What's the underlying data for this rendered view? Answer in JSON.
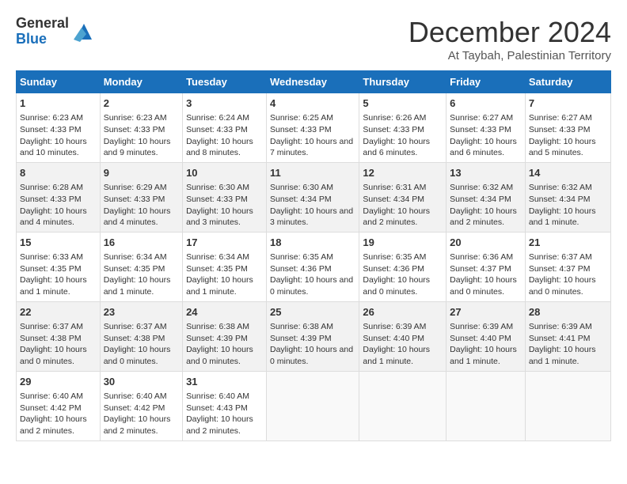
{
  "app": {
    "logo_line1": "General",
    "logo_line2": "Blue"
  },
  "title": "December 2024",
  "location": "At Taybah, Palestinian Territory",
  "days_of_week": [
    "Sunday",
    "Monday",
    "Tuesday",
    "Wednesday",
    "Thursday",
    "Friday",
    "Saturday"
  ],
  "weeks": [
    [
      {
        "day": "1",
        "sunrise": "6:23 AM",
        "sunset": "4:33 PM",
        "daylight": "10 hours and 10 minutes."
      },
      {
        "day": "2",
        "sunrise": "6:23 AM",
        "sunset": "4:33 PM",
        "daylight": "10 hours and 9 minutes."
      },
      {
        "day": "3",
        "sunrise": "6:24 AM",
        "sunset": "4:33 PM",
        "daylight": "10 hours and 8 minutes."
      },
      {
        "day": "4",
        "sunrise": "6:25 AM",
        "sunset": "4:33 PM",
        "daylight": "10 hours and 7 minutes."
      },
      {
        "day": "5",
        "sunrise": "6:26 AM",
        "sunset": "4:33 PM",
        "daylight": "10 hours and 6 minutes."
      },
      {
        "day": "6",
        "sunrise": "6:27 AM",
        "sunset": "4:33 PM",
        "daylight": "10 hours and 6 minutes."
      },
      {
        "day": "7",
        "sunrise": "6:27 AM",
        "sunset": "4:33 PM",
        "daylight": "10 hours and 5 minutes."
      }
    ],
    [
      {
        "day": "8",
        "sunrise": "6:28 AM",
        "sunset": "4:33 PM",
        "daylight": "10 hours and 4 minutes."
      },
      {
        "day": "9",
        "sunrise": "6:29 AM",
        "sunset": "4:33 PM",
        "daylight": "10 hours and 4 minutes."
      },
      {
        "day": "10",
        "sunrise": "6:30 AM",
        "sunset": "4:33 PM",
        "daylight": "10 hours and 3 minutes."
      },
      {
        "day": "11",
        "sunrise": "6:30 AM",
        "sunset": "4:34 PM",
        "daylight": "10 hours and 3 minutes."
      },
      {
        "day": "12",
        "sunrise": "6:31 AM",
        "sunset": "4:34 PM",
        "daylight": "10 hours and 2 minutes."
      },
      {
        "day": "13",
        "sunrise": "6:32 AM",
        "sunset": "4:34 PM",
        "daylight": "10 hours and 2 minutes."
      },
      {
        "day": "14",
        "sunrise": "6:32 AM",
        "sunset": "4:34 PM",
        "daylight": "10 hours and 1 minute."
      }
    ],
    [
      {
        "day": "15",
        "sunrise": "6:33 AM",
        "sunset": "4:35 PM",
        "daylight": "10 hours and 1 minute."
      },
      {
        "day": "16",
        "sunrise": "6:34 AM",
        "sunset": "4:35 PM",
        "daylight": "10 hours and 1 minute."
      },
      {
        "day": "17",
        "sunrise": "6:34 AM",
        "sunset": "4:35 PM",
        "daylight": "10 hours and 1 minute."
      },
      {
        "day": "18",
        "sunrise": "6:35 AM",
        "sunset": "4:36 PM",
        "daylight": "10 hours and 0 minutes."
      },
      {
        "day": "19",
        "sunrise": "6:35 AM",
        "sunset": "4:36 PM",
        "daylight": "10 hours and 0 minutes."
      },
      {
        "day": "20",
        "sunrise": "6:36 AM",
        "sunset": "4:37 PM",
        "daylight": "10 hours and 0 minutes."
      },
      {
        "day": "21",
        "sunrise": "6:37 AM",
        "sunset": "4:37 PM",
        "daylight": "10 hours and 0 minutes."
      }
    ],
    [
      {
        "day": "22",
        "sunrise": "6:37 AM",
        "sunset": "4:38 PM",
        "daylight": "10 hours and 0 minutes."
      },
      {
        "day": "23",
        "sunrise": "6:37 AM",
        "sunset": "4:38 PM",
        "daylight": "10 hours and 0 minutes."
      },
      {
        "day": "24",
        "sunrise": "6:38 AM",
        "sunset": "4:39 PM",
        "daylight": "10 hours and 0 minutes."
      },
      {
        "day": "25",
        "sunrise": "6:38 AM",
        "sunset": "4:39 PM",
        "daylight": "10 hours and 0 minutes."
      },
      {
        "day": "26",
        "sunrise": "6:39 AM",
        "sunset": "4:40 PM",
        "daylight": "10 hours and 1 minute."
      },
      {
        "day": "27",
        "sunrise": "6:39 AM",
        "sunset": "4:40 PM",
        "daylight": "10 hours and 1 minute."
      },
      {
        "day": "28",
        "sunrise": "6:39 AM",
        "sunset": "4:41 PM",
        "daylight": "10 hours and 1 minute."
      }
    ],
    [
      {
        "day": "29",
        "sunrise": "6:40 AM",
        "sunset": "4:42 PM",
        "daylight": "10 hours and 2 minutes."
      },
      {
        "day": "30",
        "sunrise": "6:40 AM",
        "sunset": "4:42 PM",
        "daylight": "10 hours and 2 minutes."
      },
      {
        "day": "31",
        "sunrise": "6:40 AM",
        "sunset": "4:43 PM",
        "daylight": "10 hours and 2 minutes."
      },
      null,
      null,
      null,
      null
    ]
  ]
}
